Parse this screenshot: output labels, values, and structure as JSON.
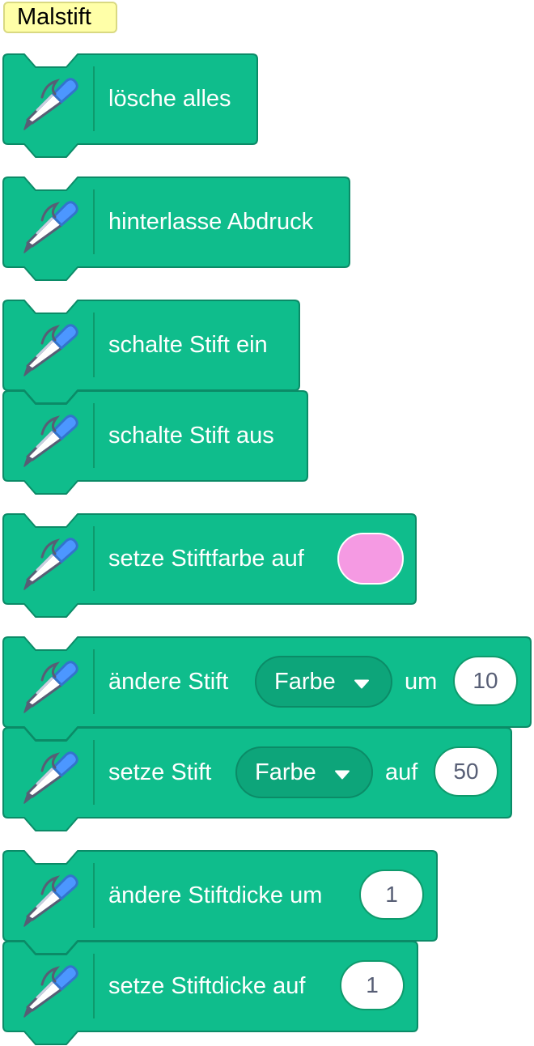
{
  "category": {
    "label": "Malstift"
  },
  "colors": {
    "block_fill": "#0fbd8c",
    "block_stroke": "#0b8b67",
    "field_fill": "#0da57a",
    "pen_color_value": "#f59ae3"
  },
  "icons": {
    "block_icon": "pen-icon"
  },
  "blocks": [
    {
      "text": "lösche alles"
    },
    {
      "text": "hinterlasse Abdruck"
    },
    {
      "text": "schalte Stift ein"
    },
    {
      "text": "schalte Stift aus"
    },
    {
      "text": "setze Stiftfarbe auf"
    },
    {
      "text_before": "ändere Stift",
      "dropdown": "Farbe",
      "text_after": "um",
      "value": "10"
    },
    {
      "text_before": "setze Stift",
      "dropdown": "Farbe",
      "text_after": "auf",
      "value": "50"
    },
    {
      "text": "ändere Stiftdicke um",
      "value": "1"
    },
    {
      "text": "setze Stiftdicke auf",
      "value": "1"
    }
  ]
}
